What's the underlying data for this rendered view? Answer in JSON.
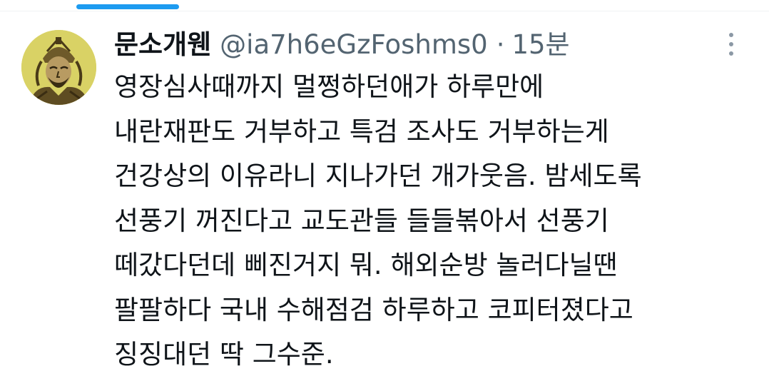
{
  "tweet": {
    "author": {
      "display_name": "문소개웬",
      "handle": "@ia7h6eGzFoshms0"
    },
    "separator": "·",
    "time_ago": "15분",
    "more_icon": "vertical-ellipsis-icon",
    "text_lines": [
      "영장심사때까지 멀쩡하던애가 하루만에",
      "내란재판도 거부하고 특검 조사도 거부하는게",
      "건강상의 이유라니 지나가던 개가웃음. 밤세도록",
      "선풍기 꺼진다고 교도관들 들들볶아서 선풍기",
      "떼갔다던데 삐진거지 뭐. 해외순방 놀러다닐땐",
      "팔팔하다 국내 수해점검 하루하고 코피터졌다고",
      "징징대던 딱 그수준."
    ]
  },
  "colors": {
    "accent": "#1d9bf0",
    "text_primary": "#0f1419",
    "text_secondary": "#536471",
    "avatar_background": "#d9d265"
  }
}
